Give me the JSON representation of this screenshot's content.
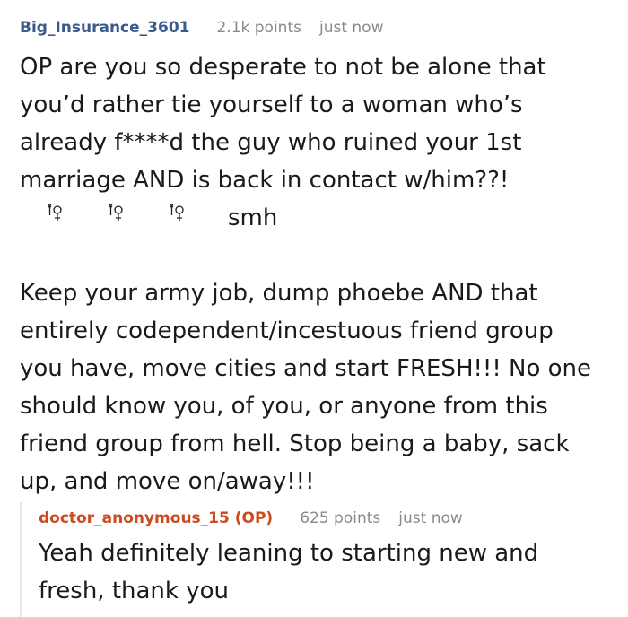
{
  "comment": {
    "username": "Big_Insurance_3601",
    "points": "2.1k points",
    "time": "just now",
    "paragraph1": [
      "OP are you so desperate to not be alone that",
      "you’d rather tie yourself to a woman who’s",
      "already f****d the guy who ruined your 1st",
      "marriage AND is back in contact w/him??!"
    ],
    "emoji_glyph": "🤦‍♀️",
    "emoji_icon_name": "facepalm-woman-icon",
    "emoji_suffix": "smh",
    "paragraph2": [
      "Keep your army job, dump phoebe AND that",
      "entirely codependent/incestuous friend group",
      "you have, move cities and start FRESH!!! No one",
      "should know you, of you, or anyone from this",
      "friend group from hell. Stop being a baby, sack",
      "up, and move on/away!!!"
    ]
  },
  "reply": {
    "username": "doctor_anonymous_15 (OP)",
    "points": "625 points",
    "time": "just now",
    "lines": [
      "Yeah definitely leaning to starting new and",
      "fresh, thank you"
    ]
  },
  "colors": {
    "username": "#3a5a8c",
    "op_username": "#cc4a1d",
    "meta": "#8a8a8a",
    "text": "#1a1a1b"
  }
}
